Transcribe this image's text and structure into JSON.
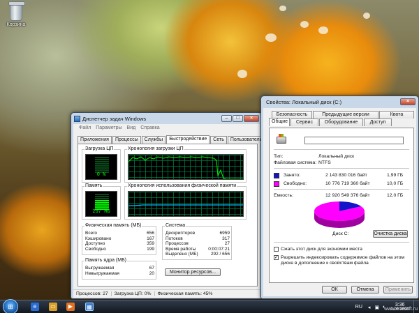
{
  "desktop": {
    "recycle_bin_label": "Корзина"
  },
  "taskmgr": {
    "title": "Диспетчер задач Windows",
    "menu": [
      "Файл",
      "Параметры",
      "Вид",
      "Справка"
    ],
    "tabs": [
      "Приложения",
      "Процессы",
      "Службы",
      "Быстродействие",
      "Сеть",
      "Пользователи"
    ],
    "active_tab": "Быстродействие",
    "cpu_group": "Загрузка ЦП",
    "cpu_value": "0 %",
    "cpu_history_group": "Хронология загрузки ЦП",
    "mem_group": "Память",
    "mem_value": "297 МБ",
    "mem_history_group": "Хронология использования физической памяти",
    "physmem": {
      "title": "Физическая память (МБ)",
      "rows": [
        {
          "label": "Всего",
          "value": "656"
        },
        {
          "label": "Кэшировано",
          "value": "167"
        },
        {
          "label": "Доступно",
          "value": "359"
        },
        {
          "label": "Свободно",
          "value": "199"
        }
      ]
    },
    "kernel": {
      "title": "Память ядра (МБ)",
      "rows": [
        {
          "label": "Выгружаемая",
          "value": "67"
        },
        {
          "label": "Невыгружаемая",
          "value": "20"
        }
      ]
    },
    "system": {
      "title": "Система",
      "rows": [
        {
          "label": "Дескрипторов",
          "value": "6959"
        },
        {
          "label": "Потоков",
          "value": "317"
        },
        {
          "label": "Процессов",
          "value": "27"
        },
        {
          "label": "Время работы",
          "value": "0:00:07:21"
        },
        {
          "label": "Выделено (МБ)",
          "value": "292 / 656"
        }
      ]
    },
    "resource_monitor_button": "Монитор ресурсов...",
    "status": {
      "processes": "Процессов: 27",
      "cpu": "Загрузка ЦП: 0%",
      "memory": "Физическая память: 45%"
    }
  },
  "props": {
    "title": "Свойства: Локальный диск (C:)",
    "tabs_row1": [
      "Безопасность",
      "Предыдущие версии",
      "Квота"
    ],
    "tabs_row2": [
      "Общие",
      "Сервис",
      "Оборудование",
      "Доступ"
    ],
    "active_tab": "Общие",
    "name_value": "",
    "type_label": "Тип:",
    "type_value": "Локальный диск",
    "fs_label": "Файловая система:",
    "fs_value": "NTFS",
    "used_label": "Занято:",
    "used_bytes": "2 143 830 016 байт",
    "used_gb": "1,99 ГБ",
    "free_label": "Свободно:",
    "free_bytes": "10 776 719 360 байт",
    "free_gb": "10,0 ГБ",
    "capacity_label": "Емкость:",
    "capacity_bytes": "12 920 549 376 байт",
    "capacity_gb": "12,0 ГБ",
    "used_fraction": 0.166,
    "used_color": "#1414c8",
    "free_color": "#ff00ff",
    "disk_label": "Диск C:",
    "cleanup_button": "Очистка диска",
    "compress_label": "Сжать этот диск для экономии места",
    "compress_checked": false,
    "index_label": "Разрешить индексировать содержимое файлов на этом диске в дополнение к свойствам файла",
    "index_checked": true,
    "ok_button": "ОК",
    "cancel_button": "Отмена",
    "apply_button": "Применить"
  },
  "taskbar": {
    "lang": "RU",
    "time": "3:36",
    "date": "1.09.2009"
  },
  "watermark": "www.enesoft.ru"
}
